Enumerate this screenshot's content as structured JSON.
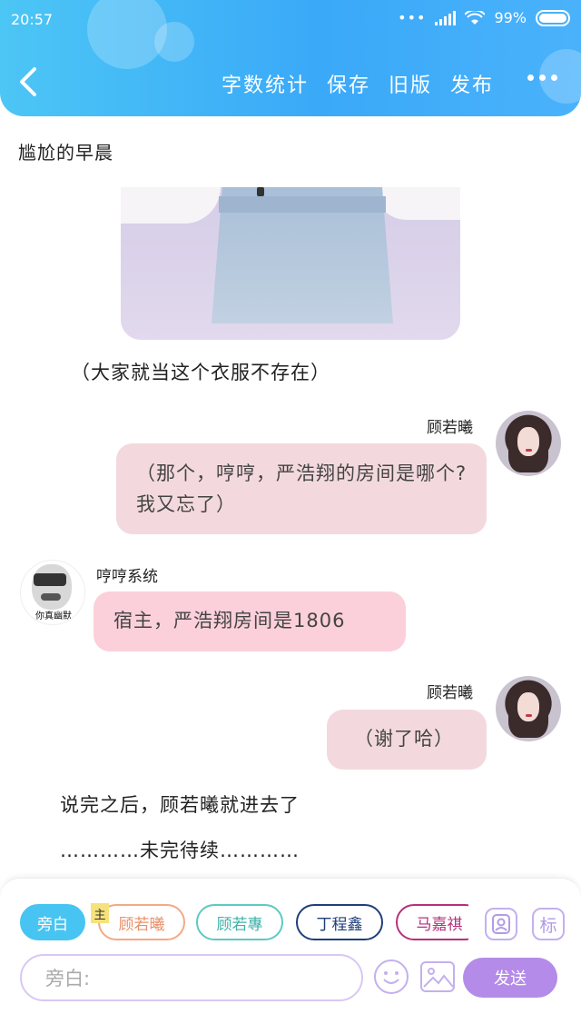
{
  "status_bar": {
    "time": "20:57",
    "battery": "99%"
  },
  "header": {
    "nav": [
      "字数统计",
      "保存",
      "旧版",
      "发布"
    ]
  },
  "story": {
    "title": "尴尬的早晨",
    "caption": "（大家就当这个衣服不存在）",
    "narration_end": "说完之后，顾若曦就进去了",
    "to_be_continued": "…………未完待续…………"
  },
  "messages": [
    {
      "speaker": "顾若曦",
      "side": "right",
      "text": "（那个，哼哼，严浩翔的房间是哪个?我又忘了）"
    },
    {
      "speaker": "哼哼系统",
      "side": "left",
      "text": "宿主，严浩翔房间是1806",
      "avatar_caption": "你真幽默"
    },
    {
      "speaker": "顾若曦",
      "side": "right",
      "text": "（谢了哈）"
    }
  ],
  "composer": {
    "chips": [
      "旁白",
      "顾若曦",
      "顾若專",
      "丁程鑫",
      "马嘉祺"
    ],
    "chip_tag": "主",
    "tag_button": "标",
    "input_placeholder": "旁白:",
    "send_label": "发送"
  },
  "colors": {
    "header_gradient_start": "#4cc6f5",
    "header_gradient_end": "#3aa9f8",
    "bubble_right": "#f3d9dd",
    "bubble_left": "#fbd0da",
    "chip_active": "#47c4f2",
    "send_button": "#b48be8"
  },
  "icons": [
    "back-icon",
    "more-icon",
    "wifi-icon",
    "signal-icon",
    "battery-icon",
    "contact-icon",
    "emoji-icon",
    "image-icon"
  ]
}
